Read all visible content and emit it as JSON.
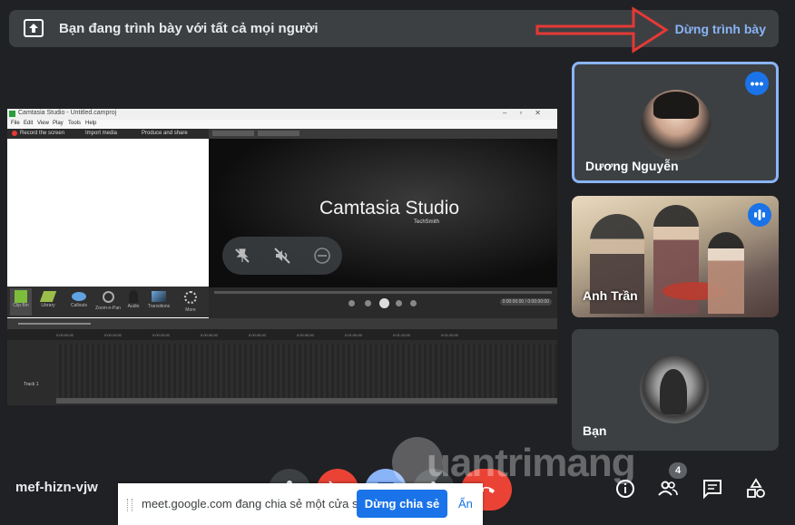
{
  "banner": {
    "text": "Bạn đang trình bày với tất cả mọi người",
    "stop_label": "Dừng trình bày",
    "icon": "present-to-all-icon"
  },
  "camtasia": {
    "window_title": "Camtasia Studio - Untitled.camproj",
    "menu": [
      "File",
      "Edit",
      "View",
      "Play",
      "Tools",
      "Help"
    ],
    "toolbar": [
      "Record the screen",
      "Import media",
      "Produce and share"
    ],
    "clip_tabs": [
      "Clip Bin",
      "Library",
      "Callouts",
      "Zoom-n-Pan",
      "Audio",
      "Transitions",
      "More"
    ],
    "logo_text": "Camtasia Studio",
    "logo_sub": "TechSmith",
    "time_display": "0:00:00:00 / 0:00:00:00",
    "track_label": "Track 1",
    "timeline_ticks": [
      "0:00:00;00",
      "0:00:10;00",
      "0:00:20;00",
      "0:00:30;00",
      "0:00:40;00",
      "0:00:50;00",
      "0:01:00;00",
      "0:01:10;00",
      "0:01:20;00"
    ]
  },
  "participants": [
    {
      "name": "Dương Nguyễn",
      "active": true,
      "badge": "more-options-icon"
    },
    {
      "name": "Anh Trần",
      "badge": "speaking-icon"
    },
    {
      "name": "Bạn"
    }
  ],
  "meeting": {
    "code": "mef-hizn-vjw",
    "people_count": "4"
  },
  "share_bar": {
    "text": "meet.google.com đang chia sẻ một cửa sổ.",
    "stop_label": "Dừng chia sẻ",
    "hide_label": "Ẩn"
  },
  "watermark": {
    "text": "uantrimang"
  },
  "colors": {
    "accent": "#8ab4f8",
    "button_blue": "#1a73e8",
    "hangup_red": "#ea4335",
    "tile_bg": "#3c4043",
    "page_bg": "#202124"
  }
}
